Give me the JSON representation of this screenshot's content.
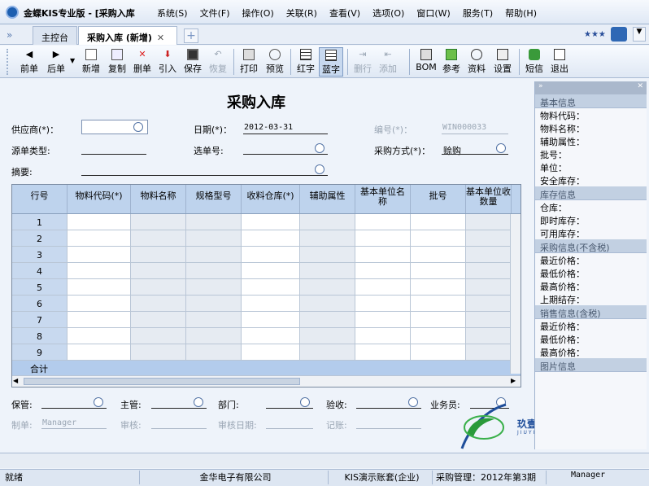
{
  "window": {
    "title": "金蝶KIS专业版 - [采购入库"
  },
  "menu": [
    "系统(S)",
    "文件(F)",
    "操作(O)",
    "关联(R)",
    "查看(V)",
    "选项(O)",
    "窗口(W)",
    "服务(T)",
    "帮助(H)"
  ],
  "tabs": [
    {
      "label": "主控台"
    },
    {
      "label": "采购入库 (新增)"
    }
  ],
  "toolbar": {
    "prev": "前单",
    "next": "后单",
    "new": "新增",
    "copy": "复制",
    "delete": "删单",
    "import": "引入",
    "save": "保存",
    "restore": "恢复",
    "print": "打印",
    "preview": "预览",
    "red": "红字",
    "blue": "蓝字",
    "delete_row": "删行",
    "add_row": "添加",
    "bom": "BOM",
    "ref": "参考",
    "info": "资料",
    "settings": "设置",
    "sms": "短信",
    "exit": "退出"
  },
  "form": {
    "title": "采购入库",
    "supplier_label": "供应商(*)：",
    "date_label": "日期(*)：",
    "date_value": "2012-03-31",
    "number_label": "编号(*)：",
    "number_value": "WIN000033",
    "source_type_label": "源单类型:",
    "select_no_label": "选单号:",
    "purchase_method_label": "采购方式(*)：",
    "purchase_method_value": "赊购",
    "summary_label": "摘要:"
  },
  "grid": {
    "columns": [
      "行号",
      "物料代码(*)",
      "物料名称",
      "规格型号",
      "收料仓库(*)",
      "辅助属性",
      "基本单位名称",
      "批号",
      "基本单位收数量"
    ],
    "rows": [
      "1",
      "2",
      "3",
      "4",
      "5",
      "6",
      "7",
      "8",
      "9"
    ],
    "total_label": "合计"
  },
  "footer": {
    "keeper_label": "保管:",
    "manager_label": "主管:",
    "dept_label": "部门:",
    "check_label": "验收:",
    "clerk_label": "业务员:",
    "maker_label": "制单:",
    "maker_value": "Manager",
    "audit_label": "审核:",
    "audit_date_label": "审核日期:",
    "post_label": "记账:"
  },
  "logo": {
    "text": "玖壹",
    "sub": "JIUYI"
  },
  "side": {
    "basic_title": "基本信息",
    "basic_items": [
      "物料代码：",
      "物料名称：",
      "辅助属性：",
      "批号：",
      "单位：",
      "安全库存："
    ],
    "stock_title": "库存信息",
    "stock_items": [
      "仓库：",
      "即时库存：",
      "可用库存："
    ],
    "purchase_title": "采购信息(不含税)",
    "purchase_items": [
      "最近价格：",
      "最低价格：",
      "最高价格：",
      "上期结存："
    ],
    "sales_title": "销售信息(含税)",
    "sales_items": [
      "最近价格：",
      "最低价格：",
      "最高价格："
    ],
    "image_title": "图片信息"
  },
  "statusbar": {
    "ready": "就绪",
    "company": "金华电子有限公司",
    "account": "KIS演示账套(企业)",
    "period": "采购管理：2012年第3期",
    "user": "Manager"
  }
}
